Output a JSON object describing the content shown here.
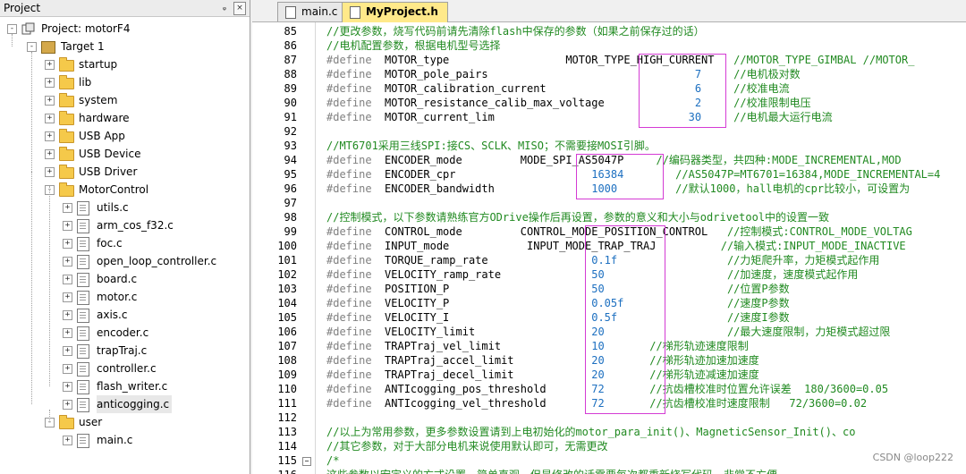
{
  "project_panel": {
    "title": "Project",
    "pin_glyph": "ᵩ",
    "close_glyph": "×",
    "root": "Project: motorF4",
    "target": "Target 1",
    "groups": [
      "startup",
      "lib",
      "system",
      "hardware",
      "USB App",
      "USB Device",
      "USB Driver"
    ],
    "motorcontrol": "MotorControl",
    "motorcontrol_files": [
      "utils.c",
      "arm_cos_f32.c",
      "foc.c",
      "open_loop_controller.c",
      "board.c",
      "motor.c",
      "axis.c",
      "encoder.c",
      "trapTraj.c",
      "controller.c",
      "flash_writer.c",
      "anticogging.c"
    ],
    "selected_file": "anticogging.c",
    "user": "user",
    "user_files": [
      "main.c"
    ]
  },
  "tabs": [
    {
      "label": "main.c",
      "active": false
    },
    {
      "label": "MyProject.h",
      "active": true
    }
  ],
  "editor": {
    "lines": [
      {
        "n": "85",
        "segs": [
          {
            "t": "//更改参数，烧写代码前请先清除flash中保存的参数（如果之前保存过的话）",
            "c": "cmt"
          }
        ]
      },
      {
        "n": "86",
        "segs": [
          {
            "t": "//电机配置参数，根据电机型号选择",
            "c": "cmt"
          }
        ]
      },
      {
        "n": "87",
        "segs": [
          {
            "t": "#define",
            "c": "kw"
          },
          {
            "t": "  MOTOR_type                  MOTOR_TYPE_HIGH_CURRENT   ",
            "c": ""
          },
          {
            "t": "//MOTOR_TYPE_GIMBAL //MOTOR_",
            "c": "cmt"
          }
        ]
      },
      {
        "n": "88",
        "segs": [
          {
            "t": "#define",
            "c": "kw"
          },
          {
            "t": "  MOTOR_pole_pairs                                ",
            "c": ""
          },
          {
            "t": "7",
            "c": "num"
          },
          {
            "t": "     ",
            "c": ""
          },
          {
            "t": "//电机极对数",
            "c": "cmt"
          }
        ]
      },
      {
        "n": "89",
        "segs": [
          {
            "t": "#define",
            "c": "kw"
          },
          {
            "t": "  MOTOR_calibration_current                       ",
            "c": ""
          },
          {
            "t": "6",
            "c": "num"
          },
          {
            "t": "     ",
            "c": ""
          },
          {
            "t": "//校准电流",
            "c": "cmt"
          }
        ]
      },
      {
        "n": "90",
        "segs": [
          {
            "t": "#define",
            "c": "kw"
          },
          {
            "t": "  MOTOR_resistance_calib_max_voltage              ",
            "c": ""
          },
          {
            "t": "2",
            "c": "num"
          },
          {
            "t": "     ",
            "c": ""
          },
          {
            "t": "//校准限制电压",
            "c": "cmt"
          }
        ]
      },
      {
        "n": "91",
        "segs": [
          {
            "t": "#define",
            "c": "kw"
          },
          {
            "t": "  MOTOR_current_lim                              ",
            "c": ""
          },
          {
            "t": "30",
            "c": "num"
          },
          {
            "t": "     ",
            "c": ""
          },
          {
            "t": "//电机最大运行电流",
            "c": "cmt"
          }
        ]
      },
      {
        "n": "92",
        "segs": []
      },
      {
        "n": "93",
        "segs": [
          {
            "t": "//MT6701采用三线SPI:接CS、SCLK、MISO；不需要接MOSI引脚。",
            "c": "cmt"
          }
        ]
      },
      {
        "n": "94",
        "segs": [
          {
            "t": "#define",
            "c": "kw"
          },
          {
            "t": "  ENCODER_mode         MODE_SPI_AS5047P     ",
            "c": ""
          },
          {
            "t": "//编码器类型，共四种:MODE_INCREMENTAL,MOD",
            "c": "cmt"
          }
        ]
      },
      {
        "n": "95",
        "segs": [
          {
            "t": "#define",
            "c": "kw"
          },
          {
            "t": "  ENCODER_cpr                     ",
            "c": ""
          },
          {
            "t": "16384",
            "c": "num"
          },
          {
            "t": "        ",
            "c": ""
          },
          {
            "t": "//AS5047P=MT6701=16384,MODE_INCREMENTAL=4",
            "c": "cmt"
          }
        ]
      },
      {
        "n": "96",
        "segs": [
          {
            "t": "#define",
            "c": "kw"
          },
          {
            "t": "  ENCODER_bandwidth               ",
            "c": ""
          },
          {
            "t": "1000",
            "c": "num"
          },
          {
            "t": "         ",
            "c": ""
          },
          {
            "t": "//默认1000，hall电机的cpr比较小，可设置为",
            "c": "cmt"
          }
        ]
      },
      {
        "n": "97",
        "segs": []
      },
      {
        "n": "98",
        "segs": [
          {
            "t": "//控制模式，以下参数请熟练官方ODrive操作后再设置，参数的意义和大小与odrivetool中的设置一致",
            "c": "cmt"
          }
        ]
      },
      {
        "n": "99",
        "segs": [
          {
            "t": "#define",
            "c": "kw"
          },
          {
            "t": "  CONTROL_mode         CONTROL_MODE_POSITION_CONTROL   ",
            "c": ""
          },
          {
            "t": "//控制模式:CONTROL_MODE_VOLTAG",
            "c": "cmt"
          }
        ]
      },
      {
        "n": "100",
        "segs": [
          {
            "t": "#define",
            "c": "kw"
          },
          {
            "t": "  INPUT_mode            INPUT_MODE_TRAP_TRAJ          ",
            "c": ""
          },
          {
            "t": "//输入模式:INPUT_MODE_INACTIVE",
            "c": "cmt"
          }
        ]
      },
      {
        "n": "101",
        "segs": [
          {
            "t": "#define",
            "c": "kw"
          },
          {
            "t": "  TORQUE_ramp_rate                ",
            "c": ""
          },
          {
            "t": "0.1f",
            "c": "num"
          },
          {
            "t": "                 ",
            "c": ""
          },
          {
            "t": "//力矩爬升率，力矩模式起作用",
            "c": "cmt"
          }
        ]
      },
      {
        "n": "102",
        "segs": [
          {
            "t": "#define",
            "c": "kw"
          },
          {
            "t": "  VELOCITY_ramp_rate              ",
            "c": ""
          },
          {
            "t": "50",
            "c": "num"
          },
          {
            "t": "                   ",
            "c": ""
          },
          {
            "t": "//加速度，速度模式起作用",
            "c": "cmt"
          }
        ]
      },
      {
        "n": "103",
        "segs": [
          {
            "t": "#define",
            "c": "kw"
          },
          {
            "t": "  POSITION_P                      ",
            "c": ""
          },
          {
            "t": "50",
            "c": "num"
          },
          {
            "t": "                   ",
            "c": ""
          },
          {
            "t": "//位置P参数",
            "c": "cmt"
          }
        ]
      },
      {
        "n": "104",
        "segs": [
          {
            "t": "#define",
            "c": "kw"
          },
          {
            "t": "  VELOCITY_P                      ",
            "c": ""
          },
          {
            "t": "0.05f",
            "c": "num"
          },
          {
            "t": "                ",
            "c": ""
          },
          {
            "t": "//速度P参数",
            "c": "cmt"
          }
        ]
      },
      {
        "n": "105",
        "segs": [
          {
            "t": "#define",
            "c": "kw"
          },
          {
            "t": "  VELOCITY_I                      ",
            "c": ""
          },
          {
            "t": "0.5f",
            "c": "num"
          },
          {
            "t": "                 ",
            "c": ""
          },
          {
            "t": "//速度I参数",
            "c": "cmt"
          }
        ]
      },
      {
        "n": "106",
        "segs": [
          {
            "t": "#define",
            "c": "kw"
          },
          {
            "t": "  VELOCITY_limit                  ",
            "c": ""
          },
          {
            "t": "20",
            "c": "num"
          },
          {
            "t": "                   ",
            "c": ""
          },
          {
            "t": "//最大速度限制，力矩模式超过限",
            "c": "cmt"
          }
        ]
      },
      {
        "n": "107",
        "segs": [
          {
            "t": "#define",
            "c": "kw"
          },
          {
            "t": "  TRAPTraj_vel_limit              ",
            "c": ""
          },
          {
            "t": "10",
            "c": "num"
          },
          {
            "t": "       ",
            "c": ""
          },
          {
            "t": "//梯形轨迹速度限制",
            "c": "cmt"
          }
        ]
      },
      {
        "n": "108",
        "segs": [
          {
            "t": "#define",
            "c": "kw"
          },
          {
            "t": "  TRAPTraj_accel_limit            ",
            "c": ""
          },
          {
            "t": "20",
            "c": "num"
          },
          {
            "t": "       ",
            "c": ""
          },
          {
            "t": "//梯形轨迹加速加速度",
            "c": "cmt"
          }
        ]
      },
      {
        "n": "109",
        "segs": [
          {
            "t": "#define",
            "c": "kw"
          },
          {
            "t": "  TRAPTraj_decel_limit            ",
            "c": ""
          },
          {
            "t": "20",
            "c": "num"
          },
          {
            "t": "       ",
            "c": ""
          },
          {
            "t": "//梯形轨迹减速加速度",
            "c": "cmt"
          }
        ]
      },
      {
        "n": "110",
        "segs": [
          {
            "t": "#define",
            "c": "kw"
          },
          {
            "t": "  ANTIcogging_pos_threshold       ",
            "c": ""
          },
          {
            "t": "72",
            "c": "num"
          },
          {
            "t": "       ",
            "c": ""
          },
          {
            "t": "//抗齿槽校准时位置允许误差  180/3600=0.05",
            "c": "cmt"
          }
        ]
      },
      {
        "n": "111",
        "segs": [
          {
            "t": "#define",
            "c": "kw"
          },
          {
            "t": "  ANTIcogging_vel_threshold       ",
            "c": ""
          },
          {
            "t": "72",
            "c": "num"
          },
          {
            "t": "       ",
            "c": ""
          },
          {
            "t": "//抗齿槽校准时速度限制   72/3600=0.02",
            "c": "cmt"
          }
        ]
      },
      {
        "n": "112",
        "segs": []
      },
      {
        "n": "113",
        "segs": [
          {
            "t": "//以上为常用参数，更多参数设置请到上电初始化的motor_para_init()、MagneticSensor_Init()、co",
            "c": "cmt"
          }
        ]
      },
      {
        "n": "114",
        "segs": [
          {
            "t": "//其它参数，对于大部分电机来说使用默认即可，无需更改",
            "c": "cmt"
          }
        ]
      },
      {
        "n": "115",
        "segs": [
          {
            "t": "/*",
            "c": "cmt"
          }
        ]
      },
      {
        "n": "116",
        "segs": [
          {
            "t": "这些参数以宏定义的方式设置，简单直观，但是修改的话需要每次都重新烧写代码，非常不方便",
            "c": "cmt"
          }
        ]
      }
    ]
  },
  "watermark": "CSDN @loop222"
}
